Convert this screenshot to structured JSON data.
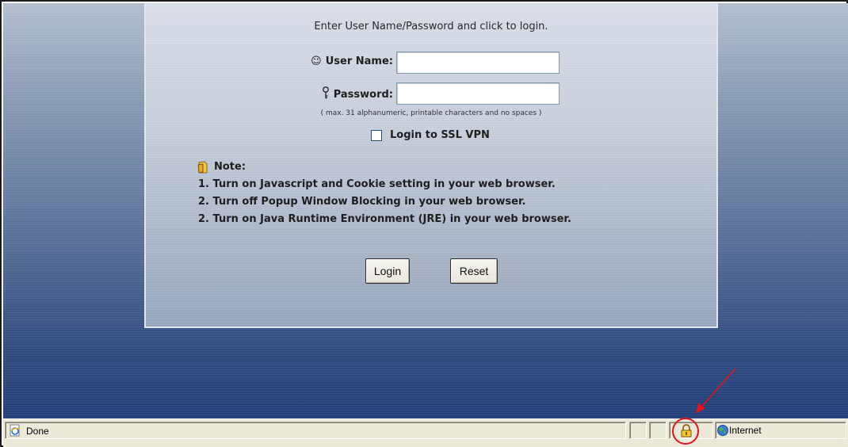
{
  "login": {
    "intro": "Enter User Name/Password and click to login.",
    "username_label": "User Name:",
    "username_value": "",
    "password_label": "Password:",
    "password_value": "",
    "hint": "( max. 31 alphanumeric, printable characters and no spaces )",
    "ssl_label": "Login to SSL VPN",
    "ssl_checked": false,
    "note_title": "Note:",
    "notes": [
      "1. Turn on Javascript and Cookie setting in your web browser.",
      "2. Turn off Popup Window Blocking in your web browser.",
      "2. Turn on Java Runtime Environment (JRE) in your web browser."
    ],
    "login_button": "Login",
    "reset_button": "Reset"
  },
  "statusbar": {
    "status_text": "Done",
    "zone_text": "Internet"
  },
  "icons": {
    "username": "smiley-icon",
    "password": "key-icon",
    "note": "note-icon",
    "page": "ie-page-icon",
    "lock": "padlock-icon",
    "zone": "globe-icon"
  },
  "colors": {
    "annotation": "#e0141a"
  }
}
